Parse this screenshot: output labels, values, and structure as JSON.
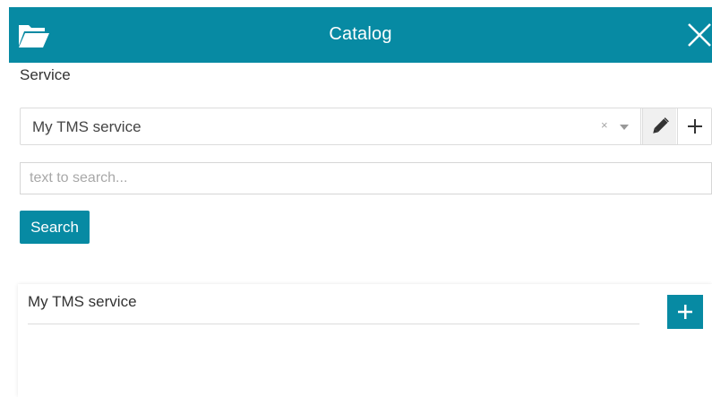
{
  "header": {
    "title": "Catalog",
    "icon": "folder-open-icon",
    "close_icon": "close-icon",
    "background": "#078aa3"
  },
  "service": {
    "label": "Service",
    "selected": "My TMS service",
    "clear_glyph": "×",
    "edit_icon": "pencil-icon",
    "add_icon": "plus-icon"
  },
  "search": {
    "placeholder": "text to search...",
    "value": "",
    "button_label": "Search"
  },
  "results": [
    {
      "title": "My TMS service",
      "add_icon": "plus-icon"
    }
  ],
  "colors": {
    "accent": "#078aa3",
    "border": "#dcdcdc",
    "text": "#333333"
  }
}
